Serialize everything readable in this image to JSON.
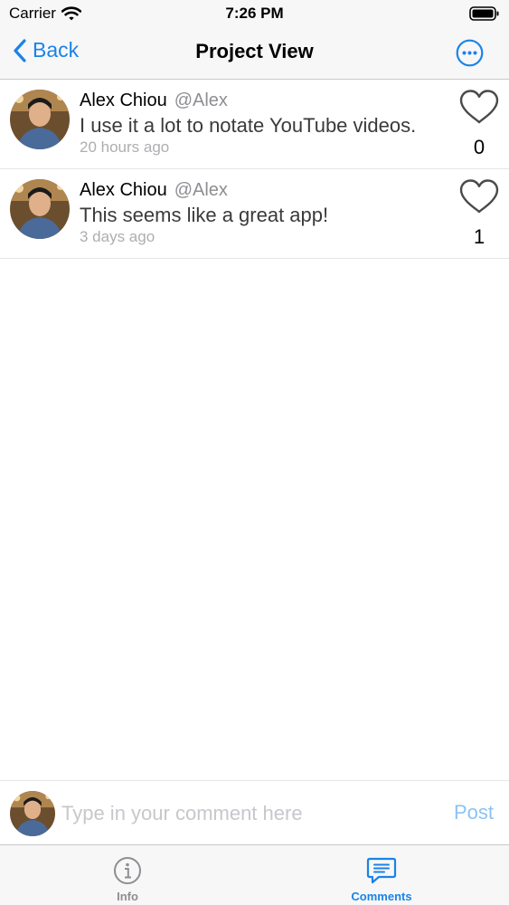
{
  "status_bar": {
    "carrier": "Carrier",
    "time": "7:26 PM"
  },
  "nav": {
    "back_label": "Back",
    "title": "Project View",
    "accent_color": "#1a83e8"
  },
  "comments": [
    {
      "name": "Alex Chiou",
      "handle": "@Alex",
      "text": "I use it a lot to notate YouTube videos.",
      "time": "20 hours ago",
      "likes": "0"
    },
    {
      "name": "Alex Chiou",
      "handle": "@Alex",
      "text": "This seems like a great app!",
      "time": "3 days ago",
      "likes": "1"
    }
  ],
  "composer": {
    "placeholder": "Type in your comment here",
    "value": "",
    "post_label": "Post"
  },
  "tabbar": {
    "items": [
      {
        "label": "Info",
        "icon": "info-circle-icon",
        "selected": false
      },
      {
        "label": "Comments",
        "icon": "comment-bubble-icon",
        "selected": true
      }
    ]
  }
}
